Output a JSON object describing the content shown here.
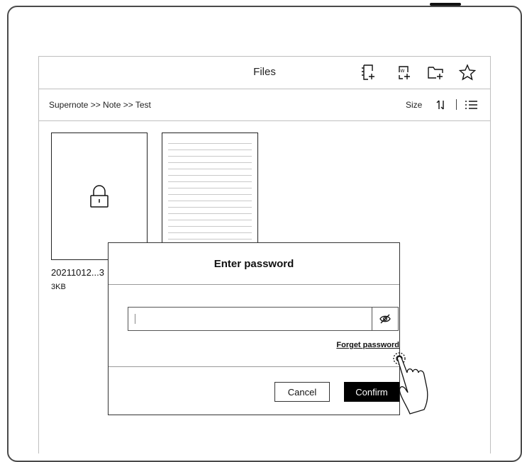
{
  "header": {
    "title": "Files",
    "icons": [
      "new-note-icon",
      "new-word-doc-icon",
      "new-folder-icon",
      "star-icon"
    ]
  },
  "breadcrumb": {
    "path": "Supernote >> Note >> Test"
  },
  "sortbar": {
    "size_label": "Size",
    "icons": [
      "sort-icon",
      "list-view-icon"
    ]
  },
  "files": [
    {
      "name": "20211012...3",
      "size": "3KB",
      "locked": true
    }
  ],
  "dialog": {
    "title": "Enter password",
    "password_value": "",
    "forget_label": "Forget password",
    "cancel_label": "Cancel",
    "confirm_label": "Confirm"
  }
}
